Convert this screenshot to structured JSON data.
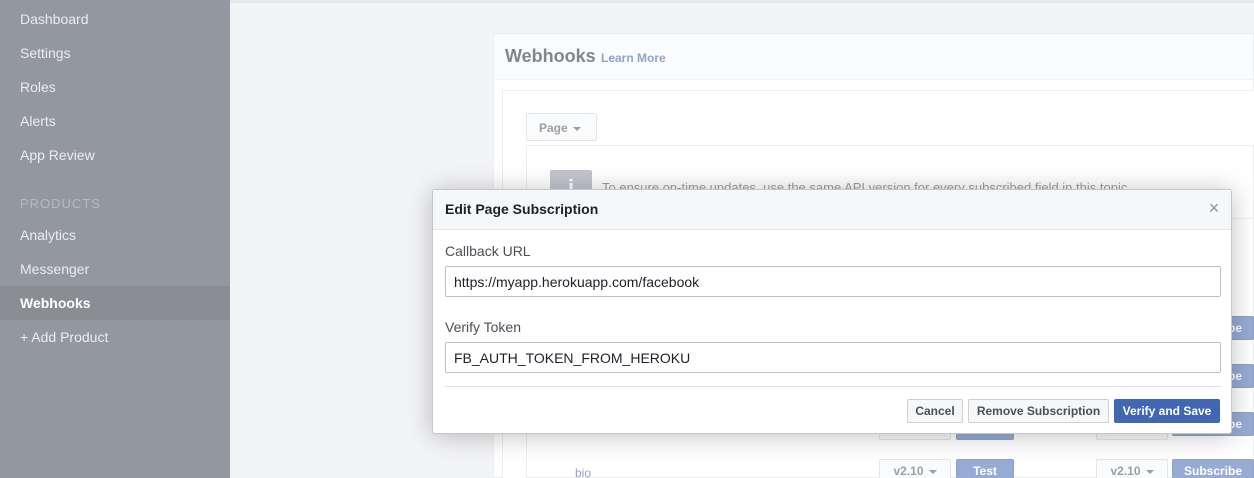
{
  "sidebar": {
    "items": [
      {
        "label": "Dashboard"
      },
      {
        "label": "Settings"
      },
      {
        "label": "Roles"
      },
      {
        "label": "Alerts"
      },
      {
        "label": "App Review"
      }
    ],
    "products_heading": "PRODUCTS",
    "products": [
      {
        "label": "Analytics"
      },
      {
        "label": "Messenger"
      },
      {
        "label": "Webhooks",
        "active": true
      },
      {
        "label": "+ Add Product"
      }
    ]
  },
  "panel": {
    "title": "Webhooks",
    "learn_more": "Learn More",
    "object_dropdown": "Page",
    "info_text": "To ensure on-time updates, use the same API version for every subscribed field in this topic.",
    "row_field": "bio",
    "version": "v2.10",
    "test_label": "Test",
    "subscribe_label": "Subscribe"
  },
  "dialog": {
    "title": "Edit Page Subscription",
    "close_glyph": "×",
    "callback_url_label": "Callback URL",
    "callback_url_value": "https://myapp.herokuapp.com/facebook",
    "verify_token_label": "Verify Token",
    "verify_token_value": "FB_AUTH_TOKEN_FROM_HEROKU",
    "cancel_label": "Cancel",
    "remove_label": "Remove Subscription",
    "save_label": "Verify and Save"
  },
  "colors": {
    "sidebar_bg": "#3b4250",
    "sidebar_active_bg": "#2b313b",
    "primary_button": "#4267b2",
    "link": "#365899"
  }
}
